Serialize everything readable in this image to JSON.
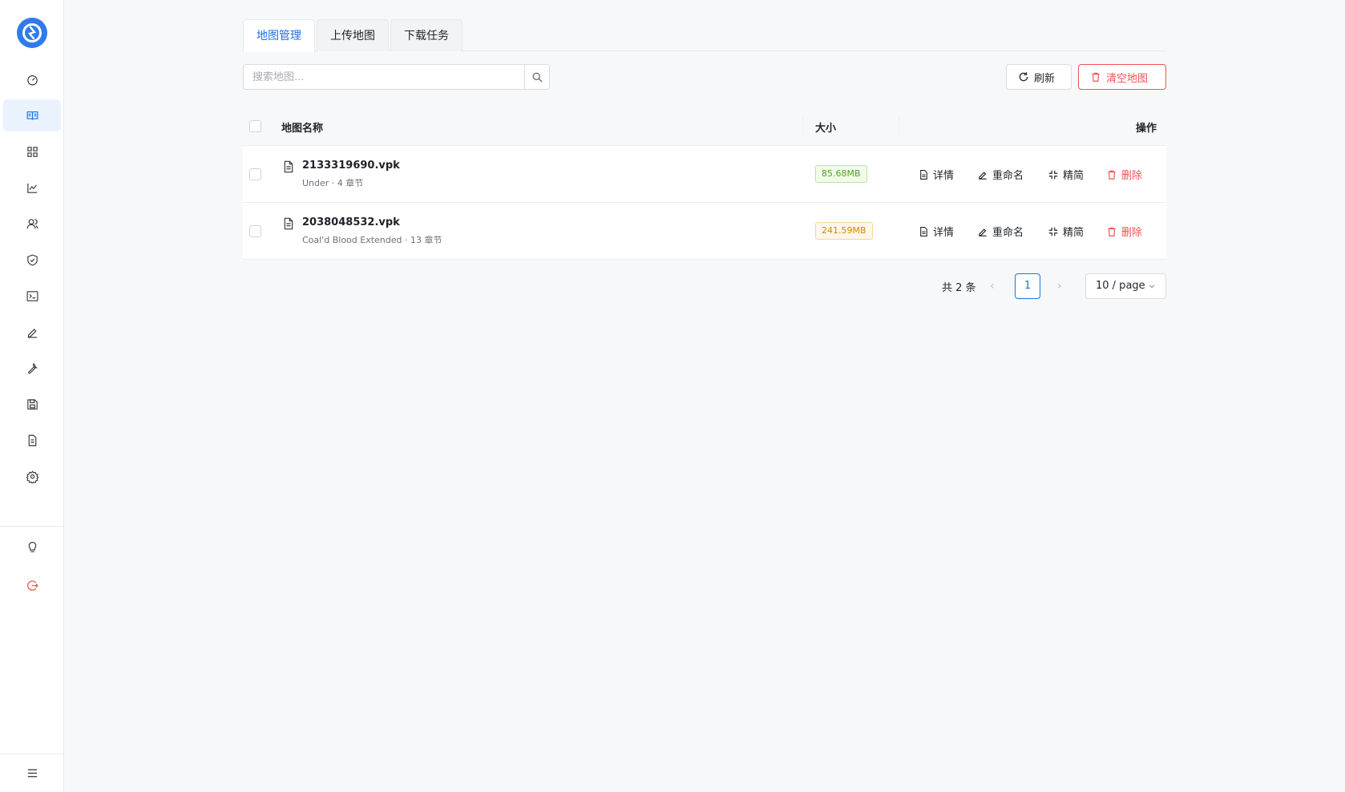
{
  "sidebar": {
    "items": [
      {
        "icon": "dashboard-icon"
      },
      {
        "icon": "map-book-icon",
        "active": true
      },
      {
        "icon": "apps-icon"
      },
      {
        "icon": "chart-line-icon"
      },
      {
        "icon": "users-icon"
      },
      {
        "icon": "shield-check-icon"
      },
      {
        "icon": "terminal-icon"
      },
      {
        "icon": "edit-icon"
      },
      {
        "icon": "wrench-icon"
      },
      {
        "icon": "save-icon"
      },
      {
        "icon": "document-icon"
      },
      {
        "icon": "gear-icon"
      },
      {
        "icon": "lightbulb-icon"
      },
      {
        "icon": "logout-icon"
      }
    ],
    "menu_icon": "hamburger-icon"
  },
  "tabs": [
    {
      "label": "地图管理",
      "active": true
    },
    {
      "label": "上传地图"
    },
    {
      "label": "下载任务"
    }
  ],
  "search": {
    "placeholder": "搜索地图..."
  },
  "toolbar": {
    "refresh_label": "刷新",
    "clear_label": "清空地图"
  },
  "table": {
    "headers": {
      "name": "地图名称",
      "size": "大小",
      "actions": "操作"
    },
    "rows": [
      {
        "name": "2133319690.vpk",
        "sub": "Under · 4 章节",
        "size": "85.68MB",
        "size_color": "green"
      },
      {
        "name": "2038048532.vpk",
        "sub": "Coal'd Blood Extended · 13 章节",
        "size": "241.59MB",
        "size_color": "orange"
      }
    ],
    "actions": {
      "details": "详情",
      "rename": "重命名",
      "simplify": "精简",
      "delete": "删除"
    }
  },
  "pagination": {
    "total": "共 2 条",
    "current_page": "1",
    "page_size": "10 / page",
    "prev": "‹",
    "next": "›"
  },
  "colors": {
    "accent": "#1a73e8",
    "danger": "#f05454",
    "tag_green": "#52a02a",
    "tag_orange": "#d48806"
  }
}
